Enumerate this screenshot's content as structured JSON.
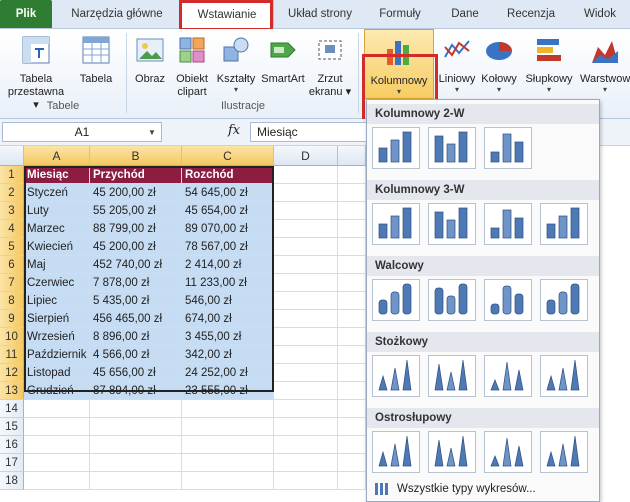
{
  "tabs": [
    "Plik",
    "Narzędzia główne",
    "Wstawianie",
    "Układ strony",
    "Formuły",
    "Dane",
    "Recenzja",
    "Widok"
  ],
  "ribbon": {
    "pivot_label": "Tabela",
    "pivot_label2": "przestawna",
    "table_label": "Tabela",
    "group_tables": "Tabele",
    "picture_label": "Obraz",
    "clipart_label": "Obiekt",
    "clipart_label2": "clipart",
    "shapes_label": "Kształty",
    "smartart_label": "SmartArt",
    "screenshot_label": "Zrzut",
    "screenshot_label2": "ekranu",
    "group_illustrations": "Ilustracje",
    "column_label": "Kolumnowy",
    "line_label": "Liniowy",
    "pie_label": "Kołowy",
    "bar_label": "Słupkowy",
    "area_label": "Warstwow"
  },
  "formula_bar": {
    "name_box": "A1",
    "fx": "fx",
    "value": "Miesiąc"
  },
  "grid": {
    "columns": [
      "A",
      "B",
      "C",
      "D"
    ],
    "rows": [
      "1",
      "2",
      "3",
      "4",
      "5",
      "6",
      "7",
      "8",
      "9",
      "10",
      "11",
      "12",
      "13",
      "14",
      "15",
      "16",
      "17",
      "18"
    ],
    "header": [
      "Miesiąc",
      "Przychód",
      "Rozchód"
    ],
    "data": [
      [
        "Styczeń",
        "45 200,00 zł",
        "54 645,00 zł"
      ],
      [
        "Luty",
        "55 205,00 zł",
        "45 654,00 zł"
      ],
      [
        "Marzec",
        "88 799,00 zł",
        "89 070,00 zł"
      ],
      [
        "Kwiecień",
        "45 200,00 zł",
        "78 567,00 zł"
      ],
      [
        "Maj",
        "452 740,00 zł",
        "2 414,00 zł"
      ],
      [
        "Czerwiec",
        "7 878,00 zł",
        "11 233,00 zł"
      ],
      [
        "Lipiec",
        "5 435,00 zł",
        "546,00 zł"
      ],
      [
        "Sierpień",
        "456 465,00 zł",
        "674,00 zł"
      ],
      [
        "Wrzesień",
        "8 896,00 zł",
        "3 455,00 zł"
      ],
      [
        "Październik",
        "4 566,00 zł",
        "342,00 zł"
      ],
      [
        "Listopad",
        "45 656,00 zł",
        "24 252,00 zł"
      ],
      [
        "Grudzień",
        "87 894,00 zł",
        "23 555,00 zł"
      ]
    ]
  },
  "dropdown": {
    "sections": [
      "Kolumnowy 2-W",
      "Kolumnowy 3-W",
      "Walcowy",
      "Stożkowy",
      "Ostrosłupowy"
    ],
    "all_types": "Wszystkie typy wykresów..."
  },
  "colors": {
    "file_tab": "#2f7d32",
    "header_fill": "#8c1d40",
    "data_fill": "#c5dcf3",
    "highlight": "#d32a2a"
  }
}
